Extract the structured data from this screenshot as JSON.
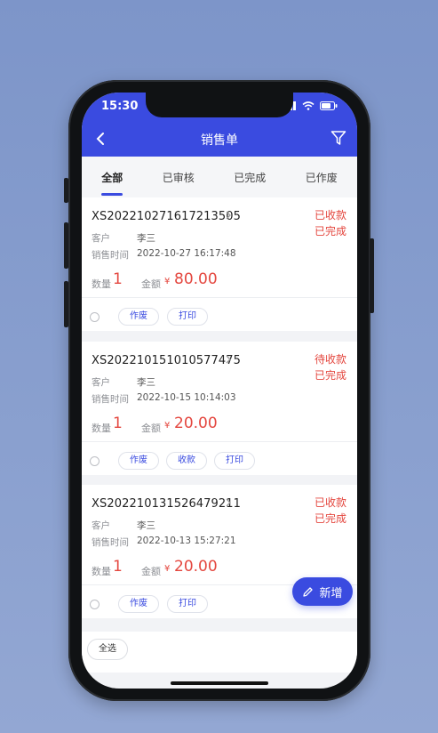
{
  "status_bar": {
    "time": "15:30"
  },
  "nav": {
    "title": "销售单"
  },
  "tabs": [
    "全部",
    "已审核",
    "已完成",
    "已作废"
  ],
  "labels": {
    "customer": "客户",
    "sale_time": "销售时间",
    "qty": "数量",
    "amount": "金额",
    "currency": "¥"
  },
  "orders": [
    {
      "no": "XS202210271617213505",
      "pay_status": "已收款",
      "status": "已完成",
      "customer": "李三",
      "time": "2022-10-27 16:17:48",
      "qty": "1",
      "amount": "80.00",
      "actions": [
        "作废",
        "打印"
      ]
    },
    {
      "no": "XS202210151010577475",
      "pay_status": "待收款",
      "status": "已完成",
      "customer": "李三",
      "time": "2022-10-15 10:14:03",
      "qty": "1",
      "amount": "20.00",
      "actions": [
        "作废",
        "收款",
        "打印"
      ]
    },
    {
      "no": "XS202210131526479211",
      "pay_status": "已收款",
      "status": "已完成",
      "customer": "李三",
      "time": "2022-10-13 15:27:21",
      "qty": "1",
      "amount": "20.00",
      "actions": [
        "作废",
        "打印"
      ]
    }
  ],
  "fab": {
    "label": "新增"
  },
  "bottom": {
    "select_all": "全选"
  },
  "colors": {
    "primary": "#3a4be0",
    "red": "#e4473f"
  }
}
